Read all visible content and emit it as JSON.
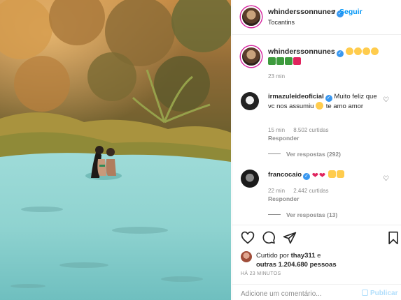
{
  "post": {
    "author": "whinderssonnunes",
    "follow_label": "Seguir",
    "separator": "•",
    "location": "Tocantins",
    "caption_time": "23 min"
  },
  "comments": [
    {
      "username": "irmazuleideoficial",
      "text": "Muito feliz que vc nos assumiu",
      "text_after": "te amo amor",
      "time": "15 min",
      "likes": "8.502 curtidas",
      "reply_label": "Responder",
      "view_replies": "Ver respostas (292)"
    },
    {
      "username": "francocaio",
      "time": "22 min",
      "likes": "2.442 curtidas",
      "reply_label": "Responder",
      "view_replies": "Ver respostas (13)"
    }
  ],
  "likes": {
    "prefix": "Curtido por",
    "user": "thay311",
    "conjunction": "e",
    "others": "outras 1.204.680 pessoas"
  },
  "timestamp": "HÁ 23 MINUTOS",
  "comment_box": {
    "placeholder": "Adicione um comentário...",
    "publish_label": "Publicar"
  },
  "colors": {
    "accent": "#0095f6",
    "verified": "#3897f0",
    "water": "#8fd3d1",
    "foliage": "#c9893a"
  },
  "icons": [
    "verified-icon",
    "heart-icon",
    "comment-icon",
    "share-icon",
    "bookmark-icon"
  ]
}
